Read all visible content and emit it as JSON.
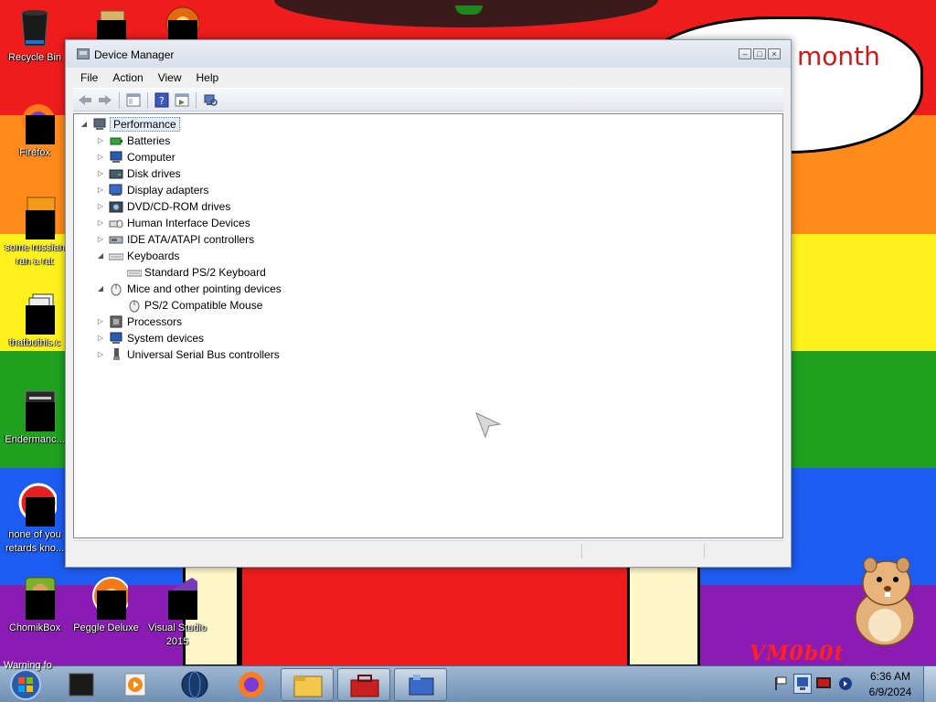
{
  "wallpaper": {
    "stripes": [
      "#ee1c1c",
      "#ff8a1c",
      "#fff21c",
      "#1fa01f",
      "#1c5cf0",
      "#8a1cb4"
    ],
    "bubble_text": "month",
    "vm_text": "VM0b0t"
  },
  "desktop_icons": [
    {
      "label": "Recycle Bin",
      "icon": "recycle-bin-icon"
    },
    {
      "label": "Firefox",
      "icon": "firefox-icon"
    },
    {
      "label": "some russian",
      "label2": "ran a rat",
      "icon": "exe-file-icon"
    },
    {
      "label": "thatbuthis.c",
      "icon": "document-stack-icon"
    },
    {
      "label": "Endermanc...",
      "icon": "app-window-icon"
    },
    {
      "label": "none of you",
      "label2": "retards kno...",
      "icon": "red-app-icon"
    },
    {
      "label": "ChomikBox",
      "icon": "chomikbox-icon"
    },
    {
      "label": "Peggle Deluxe",
      "icon": "peggle-icon"
    },
    {
      "label": "Visual Studio",
      "label2": "2015",
      "icon": "visual-studio-icon"
    }
  ],
  "window": {
    "title": "Device Manager",
    "menu": [
      "File",
      "Action",
      "View",
      "Help"
    ],
    "root": "Performance",
    "tree": [
      {
        "label": "Batteries",
        "expanded": false,
        "icon": "battery-icon"
      },
      {
        "label": "Computer",
        "expanded": false,
        "icon": "computer-icon"
      },
      {
        "label": "Disk drives",
        "expanded": false,
        "icon": "disk-drive-icon"
      },
      {
        "label": "Display adapters",
        "expanded": false,
        "icon": "display-adapter-icon"
      },
      {
        "label": "DVD/CD-ROM drives",
        "expanded": false,
        "icon": "dvd-drive-icon"
      },
      {
        "label": "Human Interface Devices",
        "expanded": false,
        "icon": "hid-icon"
      },
      {
        "label": "IDE ATA/ATAPI controllers",
        "expanded": false,
        "icon": "ide-controller-icon"
      },
      {
        "label": "Keyboards",
        "expanded": true,
        "icon": "keyboard-icon",
        "children": [
          "Standard PS/2 Keyboard"
        ]
      },
      {
        "label": "Mice and other pointing devices",
        "expanded": true,
        "icon": "mouse-icon",
        "children": [
          "PS/2 Compatible Mouse"
        ]
      },
      {
        "label": "Processors",
        "expanded": false,
        "icon": "processor-icon"
      },
      {
        "label": "System devices",
        "expanded": false,
        "icon": "system-device-icon"
      },
      {
        "label": "Universal Serial Bus controllers",
        "expanded": false,
        "icon": "usb-icon"
      }
    ]
  },
  "taskbar": {
    "start_overlay_text": "Warning fo",
    "time": "6:36 AM",
    "date": "6/9/2024"
  }
}
